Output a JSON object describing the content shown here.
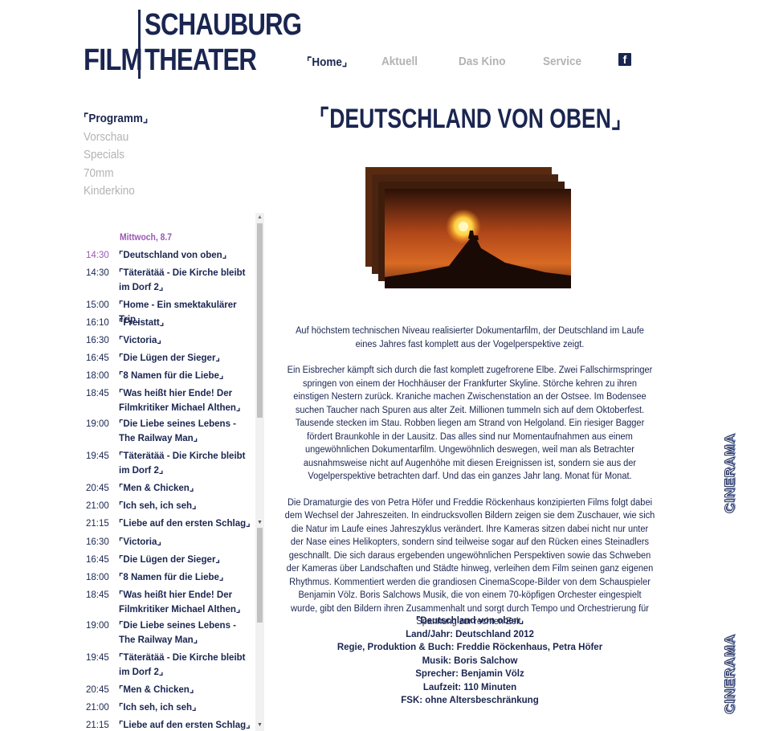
{
  "logo": {
    "film": "FILM",
    "schauburg": "SCHAUBURG",
    "theater": "THEATER"
  },
  "nav": {
    "items": [
      {
        "label": "Home",
        "active": true
      },
      {
        "label": "Aktuell",
        "active": false
      },
      {
        "label": "Das Kino",
        "active": false
      },
      {
        "label": "Service",
        "active": false
      }
    ],
    "facebook_icon": "f"
  },
  "subnav": [
    "Programm",
    "Vorschau",
    "Specials",
    "70mm",
    "Kinderkino"
  ],
  "schedule": {
    "day": "Mittwoch, 8.7",
    "rows": [
      {
        "time": "14:30",
        "title": "Deutschland von oben",
        "current": true
      },
      {
        "time": "14:30",
        "title": "Täterätää - Die Kirche bleibt im Dorf 2"
      },
      {
        "time": "15:00",
        "title": "Home - Ein smektakulärer Trip"
      },
      {
        "time": "16:10",
        "title": "Freistatt"
      },
      {
        "time": "16:30",
        "title": "Victoria"
      },
      {
        "time": "16:45",
        "title": "Die Lügen der Sieger"
      },
      {
        "time": "18:00",
        "title": "8 Namen für die Liebe"
      },
      {
        "time": "18:45",
        "title": "Was heißt hier Ende! Der Filmkritiker Michael Althen"
      },
      {
        "time": "19:00",
        "title": "Die Liebe seines Lebens - The Railway Man"
      },
      {
        "time": "19:45",
        "title": "Täterätää - Die Kirche bleibt im Dorf 2"
      },
      {
        "time": "20:45",
        "title": "Men & Chicken"
      },
      {
        "time": "21:00",
        "title": "Ich seh, ich seh"
      },
      {
        "time": "21:15",
        "title": "Liebe auf den ersten Schlag"
      },
      {
        "time": "16:30",
        "title": "Victoria"
      },
      {
        "time": "16:45",
        "title": "Die Lügen der Sieger"
      },
      {
        "time": "18:00",
        "title": "8 Namen für die Liebe"
      },
      {
        "time": "18:45",
        "title": "Was heißt hier Ende! Der Filmkritiker Michael Althen"
      },
      {
        "time": "19:00",
        "title": "Die Liebe seines Lebens - The Railway Man"
      },
      {
        "time": "19:45",
        "title": "Täterätää - Die Kirche bleibt im Dorf 2"
      },
      {
        "time": "20:45",
        "title": "Men & Chicken"
      },
      {
        "time": "21:00",
        "title": "Ich seh, ich seh"
      },
      {
        "time": "21:15",
        "title": "Liebe auf den ersten Schlag"
      }
    ]
  },
  "main": {
    "title": "DEUTSCHLAND VON OBEN",
    "paragraphs": [
      "Auf höchstem technischen Niveau realisierter Dokumentarfilm, der Deutschland im Laufe eines Jahres fast komplett aus der Vogelperspektive zeigt.",
      "Ein Eisbrecher kämpft sich durch die fast komplett zugefrorene Elbe. Zwei Fallschirmspringer springen von einem der Hochhäuser der Frankfurter Skyline. Störche kehren zu ihren einstigen Nestern zurück. Kraniche machen Zwischenstation an der Ostsee. Im Bodensee suchen Taucher nach Spuren aus alter Zeit. Millionen tummeln sich auf dem Oktoberfest. Tausende stecken im Stau. Robben liegen am Strand von Helgoland. Ein riesiger Bagger fördert Braunkohle in der Lausitz. Das alles sind nur Momentaufnahmen aus einem ungewöhnlichen Dokumentarfilm. Ungewöhnlich deswegen, weil man als Betrachter ausnahmsweise nicht auf Augenhöhe mit diesen Ereignissen ist, sondern sie aus der Vogelperspektive betrachten darf. Und das ein ganzes Jahr lang. Monat für Monat.",
      "Die Dramaturgie des von Petra Höfer und Freddie Röckenhaus konzipierten Films folgt dabei dem Wechsel der Jahreszeiten. In eindrucksvollen Bildern zeigen sie dem Zuschauer, wie sich die Natur im Laufe eines Jahreszyklus verändert. Ihre Kameras sitzen dabei nicht nur unter der Nase eines Helikopters, sondern sind teilweise sogar auf den Rücken eines Steinadlers geschnallt. Die sich daraus ergebenden ungewöhnlichen Perspektiven sowie das Schweben der Kameras über Landschaften und Städte hinweg, verleihen dem Film seinen ganz eigenen Rhythmus. Kommentiert werden die grandiosen CinemaScope-Bilder von dem Schauspieler Benjamin Völz. Boris Salchows Musik, die von einem 70-köpfigen Orchester eingespielt wurde, gibt den Bildern ihren Zusammenhalt und sorgt durch Tempo und Orchestrierung für Spannung zur rechten Zeit."
    ],
    "credits": {
      "title": "Deutschland von oben",
      "lines": [
        "Land/Jahr: Deutschland 2012",
        "Regie, Produktion & Buch: Freddie Röckenhaus, Petra Höfer",
        "Musik: Boris Salchow",
        "Sprecher: Benjamin Völz",
        "Laufzeit: 110 Minuten",
        "FSK: ohne Altersbeschränkung"
      ]
    }
  },
  "badges": [
    "CINERAMA",
    "CINERAMA"
  ],
  "colors": {
    "navy": "#1a2550",
    "inactive": "#b3b3b3",
    "highlight": "#9b59b6"
  }
}
